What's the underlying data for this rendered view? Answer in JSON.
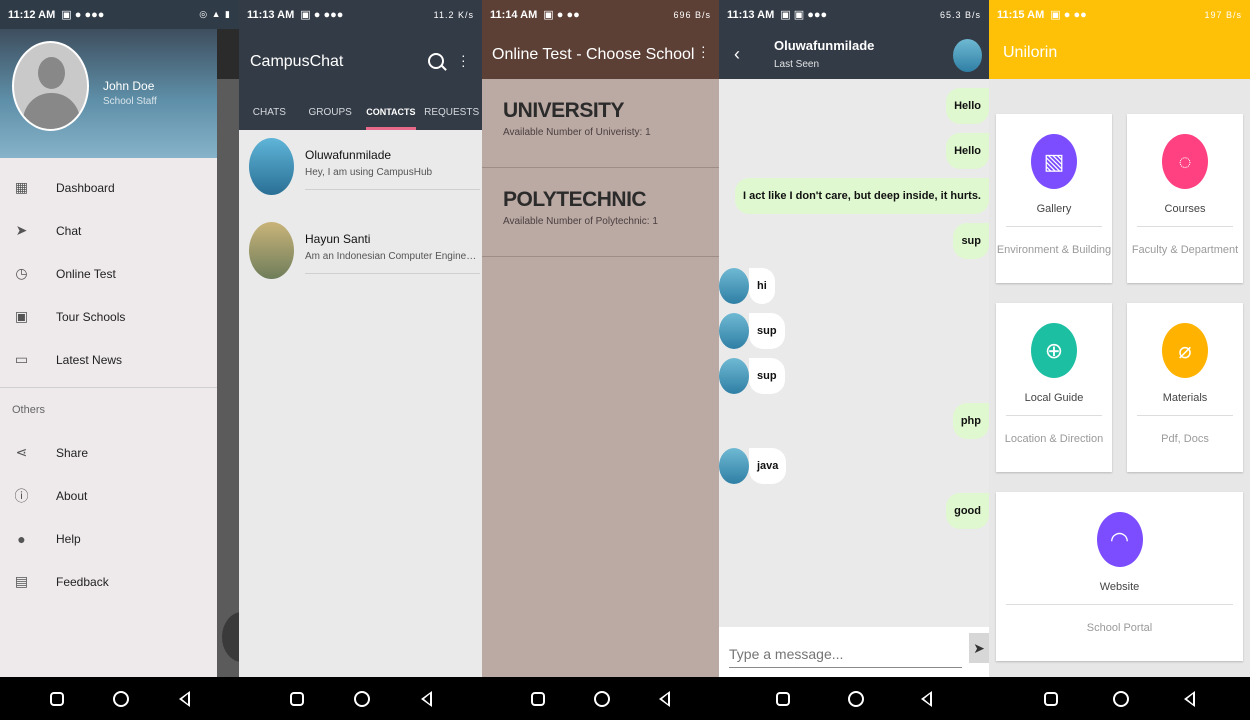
{
  "screen1": {
    "status_time": "11:12 AM",
    "user": {
      "name": "John Doe",
      "role": "School Staff"
    },
    "menu": [
      {
        "label": "Dashboard",
        "icon": "dashboard-icon"
      },
      {
        "label": "Chat",
        "icon": "send-icon"
      },
      {
        "label": "Online Test",
        "icon": "timer-icon"
      },
      {
        "label": "Tour Schools",
        "icon": "video-library-icon"
      },
      {
        "label": "Latest News",
        "icon": "monitor-icon"
      }
    ],
    "section_title": "Others",
    "other_menu": [
      {
        "label": "Share",
        "icon": "share-icon"
      },
      {
        "label": "About",
        "icon": "info-icon"
      },
      {
        "label": "Help",
        "icon": "help-icon"
      },
      {
        "label": "Feedback",
        "icon": "feedback-icon"
      }
    ]
  },
  "screen2": {
    "status_time": "11:13 AM",
    "status_speed": "11.2 K/s",
    "app_title": "CampusChat",
    "tabs": [
      "CHATS",
      "GROUPS",
      "CONTACTS",
      "REQUESTS"
    ],
    "active_tab": "CONTACTS",
    "contacts": [
      {
        "name": "Oluwafunmilade",
        "status": "Hey, I am using CampusHub"
      },
      {
        "name": "Hayun Santi",
        "status": "Am an Indonesian Computer Engineering..."
      }
    ]
  },
  "screen3": {
    "status_time": "11:14 AM",
    "status_speed": "696 B/s",
    "app_title": "Online Test - Choose School",
    "schools": [
      {
        "name": "UNIVERSITY",
        "count_text": "Available Number of Univeristy: 1"
      },
      {
        "name": "POLYTECHNIC",
        "count_text": "Available Number of Polytechnic: 1"
      }
    ]
  },
  "screen4": {
    "status_time": "11:13 AM",
    "status_speed": "65.3 B/s",
    "chat_name": "Oluwafunmilade",
    "last_seen": "Last Seen",
    "messages": [
      {
        "text": "Hello",
        "dir": "out"
      },
      {
        "text": "Hello",
        "dir": "out"
      },
      {
        "text": "I act like I don't care, but deep inside, it hurts.",
        "dir": "out"
      },
      {
        "text": "sup",
        "dir": "out"
      },
      {
        "text": "hi",
        "dir": "in"
      },
      {
        "text": "sup",
        "dir": "in"
      },
      {
        "text": "sup",
        "dir": "in"
      },
      {
        "text": "php",
        "dir": "out"
      },
      {
        "text": "java",
        "dir": "in"
      },
      {
        "text": "good",
        "dir": "out"
      }
    ],
    "input_placeholder": "Type a message..."
  },
  "screen5": {
    "status_time": "11:15 AM",
    "status_speed": "197 B/s",
    "app_title": "Unilorin",
    "cards": [
      {
        "title": "Gallery",
        "subtitle": "Environment & Building",
        "color": "#7c4dff",
        "icon": "gallery-icon"
      },
      {
        "title": "Courses",
        "subtitle": "Faculty & Department",
        "color": "#ff4081",
        "icon": "lightbulb-icon"
      },
      {
        "title": "Local Guide",
        "subtitle": "Location & Direction",
        "color": "#1dbfa3",
        "icon": "add-circle-icon"
      },
      {
        "title": "Materials",
        "subtitle": "Pdf, Docs",
        "color": "#ffb300",
        "icon": "attachment-icon"
      },
      {
        "title": "Website",
        "subtitle": "School Portal",
        "color": "#7c4dff",
        "icon": "wifi-icon"
      }
    ]
  },
  "colors": {
    "dark_bar": "#333b46",
    "brown_bar": "#5c4036",
    "amber_bar": "#ffc107",
    "tab_indicator": "#e86a8a",
    "outgoing_bubble": "#dff8cf"
  }
}
